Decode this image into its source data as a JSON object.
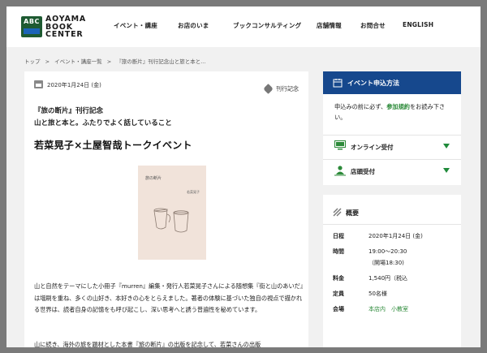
{
  "header": {
    "logo_abc": "ABC",
    "logo_lines": [
      "AOYAMA",
      "BOOK",
      "CENTER"
    ],
    "nav": [
      "イベント・講座",
      "お店のいま",
      "ブックコンサルティング",
      "店舗情報",
      "お問合せ",
      "ENGLISH"
    ]
  },
  "breadcrumb": [
    "トップ",
    ">",
    "イベント・講座一覧",
    ">",
    "『旅の断片』刊行記念山と旅と本と..."
  ],
  "article": {
    "date": "2020年1月24日 (金)",
    "tag": "刊行記念",
    "subtitle1": "『旅の断片』刊行記念",
    "subtitle2": "山と旅と本と。ふたりでよく話していること",
    "title": "若菜晃子×土屋智哉トークイベント",
    "book_title": "旅の断片",
    "book_author": "若菜晃子",
    "description": "山と自然をテーマにした小冊子『murren』編集・発行人若菜晃子さんによる随想集『街と山のあいだ』は増刷を重ね、多くの山好き、本好きの心をとらえました。著者の体験に基づいた独自の視点で描かれる世界は、読者自身の記憶をも呼び起こし、深い思考へと誘う普遍性を秘めています。",
    "description2": "山に続き、海外の旅を題材とした本書『旅の断片』の出版を記念して、若菜さんの出版"
  },
  "sidebar": {
    "apply_title": "イベント申込方法",
    "note_pre": "申込みの前に必ず、",
    "note_link": "参加規約",
    "note_post": "をお読み下さい。",
    "online": "オンライン受付",
    "store": "店頭受付",
    "overview_title": "概要",
    "info": [
      {
        "k": "日程",
        "v": "2020年1月24日 (金)"
      },
      {
        "k": "時間",
        "v": "19:00〜20:30"
      },
      {
        "k": "",
        "v": "（開場18:30)"
      },
      {
        "k": "料金",
        "v": "1,540円（税込"
      },
      {
        "k": "定員",
        "v": "50名様"
      },
      {
        "k": "会場",
        "v": "本店内　小教室"
      }
    ]
  },
  "colors": {
    "brand_green": "#1e5a32",
    "brand_blue": "#16488d",
    "link_green": "#2c8a39"
  }
}
